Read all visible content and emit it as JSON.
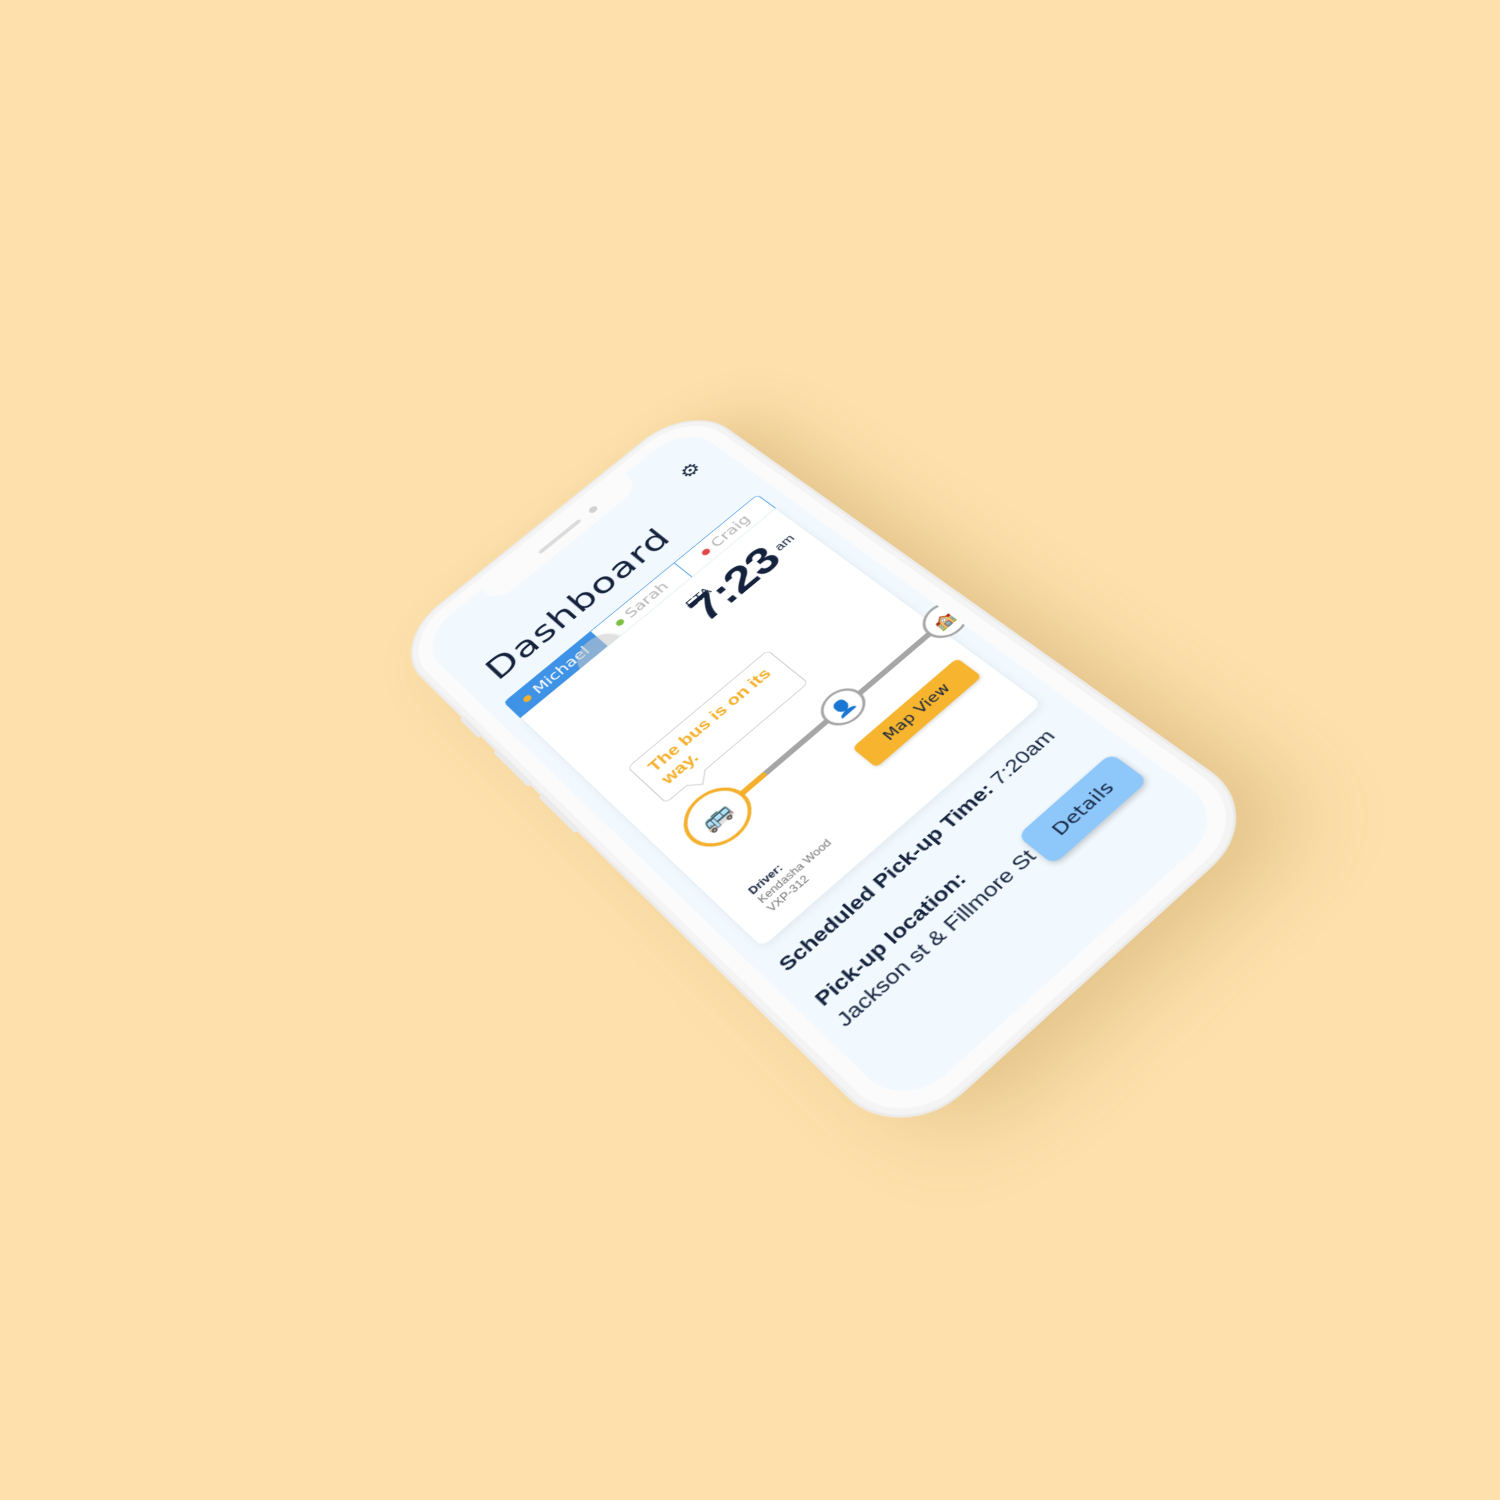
{
  "header": {
    "title": "Dashboard",
    "settings_icon": "gear-icon"
  },
  "tabs": [
    {
      "label": "Michael",
      "dot_color": "#f4b02c",
      "active": true
    },
    {
      "label": "Sarah",
      "dot_color": "#7ac143",
      "active": false
    },
    {
      "label": "Craig",
      "dot_color": "#e04848",
      "active": false
    }
  ],
  "eta": {
    "label": "ETA",
    "time": "7:23",
    "suffix": "am"
  },
  "status": {
    "message": "The bus is on its way."
  },
  "route": {
    "stops": [
      {
        "icon": "bus-icon"
      },
      {
        "icon": "person-icon"
      },
      {
        "icon": "school-icon"
      }
    ]
  },
  "actions": {
    "map_view_label": "Map View",
    "details_label": "Details"
  },
  "driver": {
    "label": "Driver:",
    "name": "Kendasha Wood",
    "plate": "VXP-312"
  },
  "pickup": {
    "time_label": "Scheduled Pick-up Time:",
    "time_value": "7:20am",
    "location_label": "Pick-up location:",
    "location_value": "Jackson st & Fillmore St"
  },
  "colors": {
    "background": "#fde0ab",
    "accent_blue": "#3f93e6",
    "accent_yellow": "#f4b02c",
    "details_button": "#8ec8fb",
    "text_dark": "#14223d"
  }
}
